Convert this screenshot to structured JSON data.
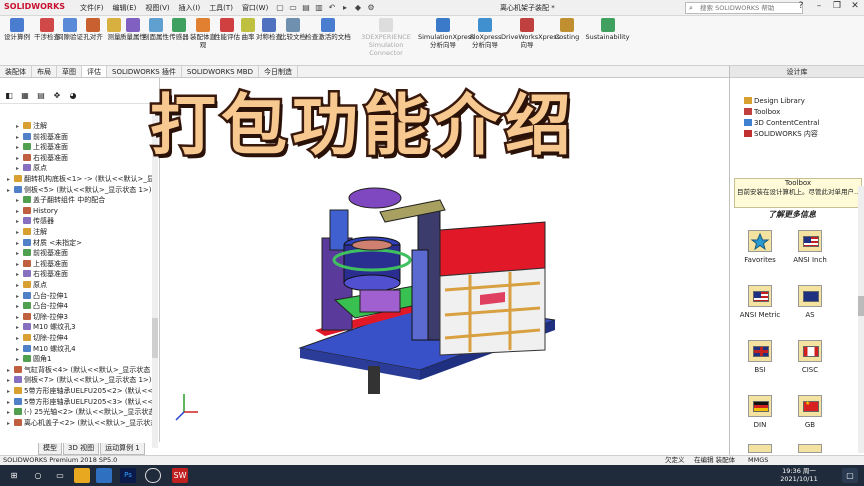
{
  "app": {
    "logo": "SOLIDWORKS",
    "doc_title": "离心机架子装配 *",
    "search_placeholder": "搜索 SOLIDWORKS 帮助"
  },
  "menus": [
    "文件(F)",
    "编辑(E)",
    "视图(V)",
    "插入(I)",
    "工具(T)",
    "窗口(W)"
  ],
  "ribbon": [
    {
      "label": "设计算例"
    },
    {
      "label": "干涉检查"
    },
    {
      "label": "间隙验证"
    },
    {
      "label": "孔对齐"
    },
    {
      "label": "测量"
    },
    {
      "label": "质量属性"
    },
    {
      "label": "剖面属性"
    },
    {
      "label": "传感器"
    },
    {
      "label": "装配体直观"
    },
    {
      "label": "性能评估"
    },
    {
      "label": "曲率"
    },
    {
      "label": "对称检查"
    },
    {
      "label": "比较文档"
    },
    {
      "label": "检查激活的文档"
    },
    {
      "label": "3DEXPERIENCE Simulation Connector"
    },
    {
      "label": "SimulationXpress 分析向导"
    },
    {
      "label": "FloXpress 分析向导"
    },
    {
      "label": "DriveWorksXpress 向导"
    },
    {
      "label": "Costing"
    },
    {
      "label": "Sustainability"
    }
  ],
  "cmd_tabs": [
    "装配体",
    "布局",
    "草图",
    "评估",
    "SOLIDWORKS 插件",
    "SOLIDWORKS MBD",
    "今日制造"
  ],
  "cmd_tab_active": "评估",
  "tree": [
    {
      "label": "注解",
      "level": 2
    },
    {
      "label": "前视基准面",
      "level": 2
    },
    {
      "label": "上视基准面",
      "level": 2
    },
    {
      "label": "右视基准面",
      "level": 2
    },
    {
      "label": "原点",
      "level": 2
    },
    {
      "label": "翻转机构底板<1> -> (默认<<默认>_显",
      "level": 1
    },
    {
      "label": "侧板<5> (默认<<默认>_显示状态 1>)",
      "level": 1
    },
    {
      "label": "盖子翻转组件 中的配合",
      "level": 2
    },
    {
      "label": "History",
      "level": 2
    },
    {
      "label": "传感器",
      "level": 2
    },
    {
      "label": "注解",
      "level": 2
    },
    {
      "label": "材质 <未指定>",
      "level": 2
    },
    {
      "label": "前视基准面",
      "level": 2
    },
    {
      "label": "上视基准面",
      "level": 2
    },
    {
      "label": "右视基准面",
      "level": 2
    },
    {
      "label": "原点",
      "level": 2
    },
    {
      "label": "凸台-拉伸1",
      "level": 2
    },
    {
      "label": "凸台-拉伸4",
      "level": 2
    },
    {
      "label": "切除-拉伸3",
      "level": 2
    },
    {
      "label": "M10 螺纹孔3",
      "level": 2
    },
    {
      "label": "切除-拉伸4",
      "level": 2
    },
    {
      "label": "M10 螺纹孔4",
      "level": 2
    },
    {
      "label": "圆角1",
      "level": 2
    },
    {
      "label": "气缸背板<4> (默认<<默认>_显示状态",
      "level": 1
    },
    {
      "label": "侧板<7> (默认<<默认>_显示状态 1>)",
      "level": 1
    },
    {
      "label": "5带方形座轴承UELFU205<2> (默认<<",
      "level": 1
    },
    {
      "label": "5带方形座轴承UELFU205<3> (默认<<",
      "level": 1
    },
    {
      "label": "(-) 25光轴<2> (默认<<默认>_显示状态",
      "level": 1
    },
    {
      "label": "离心机盖子<2> (默认<<默认>_显示状态",
      "level": 1
    }
  ],
  "bottom_tabs": [
    "模型",
    "3D 视图",
    "运动算例 1"
  ],
  "status": {
    "left": "SOLIDWORKS Premium 2018 SP5.0",
    "mid1": "欠定义",
    "mid2": "在编辑 装配体",
    "mid3": "MMGS"
  },
  "overlay_title": "打包功能介绍",
  "design_library": {
    "header": "设计库",
    "items": [
      "Design Library",
      "Toolbox",
      "3D ContentCentral",
      "SOLIDWORKS 内容"
    ],
    "info_title": "Toolbox",
    "info_text": "目前安装在设计算机上。尽管此对单用户…",
    "info_link": "了解更多信息",
    "grid": [
      {
        "label": "Favorites",
        "flag": "favorites"
      },
      {
        "label": "ANSI Inch",
        "flag": "usa"
      },
      {
        "label": "ANSI Metric",
        "flag": "usa"
      },
      {
        "label": "AS",
        "flag": "australia"
      },
      {
        "label": "BSI",
        "flag": "uk"
      },
      {
        "label": "CISC",
        "flag": "canada"
      },
      {
        "label": "DIN",
        "flag": "germany"
      },
      {
        "label": "GB",
        "flag": "china"
      }
    ]
  },
  "taskbar": {
    "time": "19:36 周一",
    "date": "2021/10/11"
  },
  "colors": {
    "title_fill": "#f7c990",
    "title_stroke": "#3a1a0c",
    "taskbar": "#1f2a3a",
    "machine_red": "#e01828",
    "machine_blue": "#3850c8"
  }
}
